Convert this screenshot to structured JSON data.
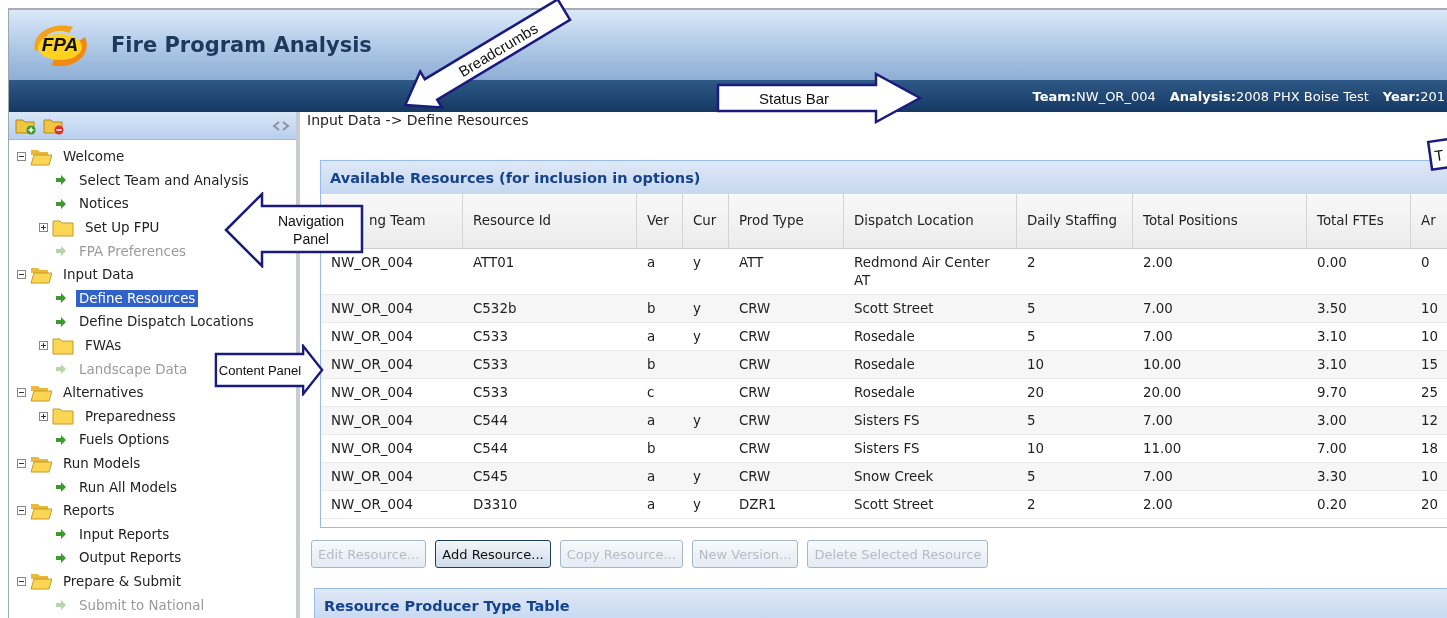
{
  "app": {
    "logo_text": "FPA",
    "title": "Fire Program Analysis"
  },
  "status_bar": [
    {
      "label": "Team:",
      "value": "NW_OR_004"
    },
    {
      "label": "Analysis:",
      "value": "2008 PHX Boise Test"
    },
    {
      "label": "Year:",
      "value": "201"
    }
  ],
  "nav_tree": [
    {
      "kind": "folder",
      "label": "Welcome",
      "expanded": true,
      "selected": false,
      "disabled": false,
      "children": [
        {
          "kind": "leaf",
          "label": "Select Team and Analysis",
          "selected": false,
          "disabled": false
        },
        {
          "kind": "leaf",
          "label": "Notices",
          "selected": false,
          "disabled": false
        },
        {
          "kind": "folder",
          "label": "Set Up FPU",
          "expanded": false,
          "selected": false,
          "disabled": false
        },
        {
          "kind": "leaf",
          "label": "FPA Preferences",
          "selected": false,
          "disabled": true
        }
      ]
    },
    {
      "kind": "folder",
      "label": "Input Data",
      "expanded": true,
      "selected": false,
      "disabled": false,
      "children": [
        {
          "kind": "leaf",
          "label": "Define Resources",
          "selected": true,
          "disabled": false
        },
        {
          "kind": "leaf",
          "label": "Define Dispatch Locations",
          "selected": false,
          "disabled": false
        },
        {
          "kind": "folder",
          "label": "FWAs",
          "expanded": false,
          "selected": false,
          "disabled": false
        },
        {
          "kind": "leaf",
          "label": "Landscape Data",
          "selected": false,
          "disabled": true
        }
      ]
    },
    {
      "kind": "folder",
      "label": "Alternatives",
      "expanded": true,
      "selected": false,
      "disabled": false,
      "children": [
        {
          "kind": "folder",
          "label": "Preparedness",
          "expanded": false,
          "selected": false,
          "disabled": false
        },
        {
          "kind": "leaf",
          "label": "Fuels Options",
          "selected": false,
          "disabled": false
        }
      ]
    },
    {
      "kind": "folder",
      "label": "Run Models",
      "expanded": true,
      "selected": false,
      "disabled": false,
      "children": [
        {
          "kind": "leaf",
          "label": "Run All Models",
          "selected": false,
          "disabled": false
        }
      ]
    },
    {
      "kind": "folder",
      "label": "Reports",
      "expanded": true,
      "selected": false,
      "disabled": false,
      "children": [
        {
          "kind": "leaf",
          "label": "Input Reports",
          "selected": false,
          "disabled": false
        },
        {
          "kind": "leaf",
          "label": "Output Reports",
          "selected": false,
          "disabled": false
        }
      ]
    },
    {
      "kind": "folder",
      "label": "Prepare & Submit",
      "expanded": true,
      "selected": false,
      "disabled": false,
      "children": [
        {
          "kind": "leaf",
          "label": "Submit to National",
          "selected": false,
          "disabled": true
        }
      ]
    }
  ],
  "breadcrumb": "Input Data -> Define Resources",
  "resources_panel": {
    "title": "Available Resources (for inclusion in options)",
    "columns": [
      "ng Team",
      "Resource Id",
      "Ver",
      "Cur",
      "Prod Type",
      "Dispatch Location",
      "Daily Staffing",
      "Total Positions",
      "Total FTEs",
      "Ar"
    ],
    "rows": [
      [
        "NW_OR_004",
        "ATT01",
        "a",
        "y",
        "ATT",
        "Redmond Air Center AT",
        "2",
        "2.00",
        "0.00",
        "0"
      ],
      [
        "NW_OR_004",
        "C532b",
        "b",
        "y",
        "CRW",
        "Scott Street",
        "5",
        "7.00",
        "3.50",
        "10"
      ],
      [
        "NW_OR_004",
        "C533",
        "a",
        "y",
        "CRW",
        "Rosedale",
        "5",
        "7.00",
        "3.10",
        "10"
      ],
      [
        "NW_OR_004",
        "C533",
        "b",
        null,
        "CRW",
        "Rosedale",
        "10",
        "10.00",
        "3.10",
        "15"
      ],
      [
        "NW_OR_004",
        "C533",
        "c",
        null,
        "CRW",
        "Rosedale",
        "20",
        "20.00",
        "9.70",
        "25"
      ],
      [
        "NW_OR_004",
        "C544",
        "a",
        "y",
        "CRW",
        "Sisters FS",
        "5",
        "7.00",
        "3.00",
        "12"
      ],
      [
        "NW_OR_004",
        "C544",
        "b",
        null,
        "CRW",
        "Sisters FS",
        "10",
        "11.00",
        "7.00",
        "18"
      ],
      [
        "NW_OR_004",
        "C545",
        "a",
        "y",
        "CRW",
        "Snow Creek",
        "5",
        "7.00",
        "3.30",
        "10"
      ],
      [
        "NW_OR_004",
        "D3310",
        "a",
        "y",
        "DZR1",
        "Scott Street",
        "2",
        "2.00",
        "0.20",
        "20"
      ]
    ],
    "buttons": [
      {
        "label": "Edit Resource...",
        "disabled": true
      },
      {
        "label": "Add Resource...",
        "disabled": false
      },
      {
        "label": "Copy Resource...",
        "disabled": true
      },
      {
        "label": "New Version...",
        "disabled": true
      },
      {
        "label": "Delete Selected Resource",
        "disabled": true
      }
    ]
  },
  "next_panel": {
    "title": "Resource Producer Type Table"
  },
  "callouts": [
    {
      "kind": "arrow-down-left",
      "text": "Breadcrumbs"
    },
    {
      "kind": "arrow-right",
      "text": "Status Bar"
    },
    {
      "kind": "arrow-left",
      "text": "Navigation Panel"
    },
    {
      "kind": "arrow-right-small",
      "text": "Content Panel"
    },
    {
      "kind": "box",
      "text": "T"
    }
  ]
}
